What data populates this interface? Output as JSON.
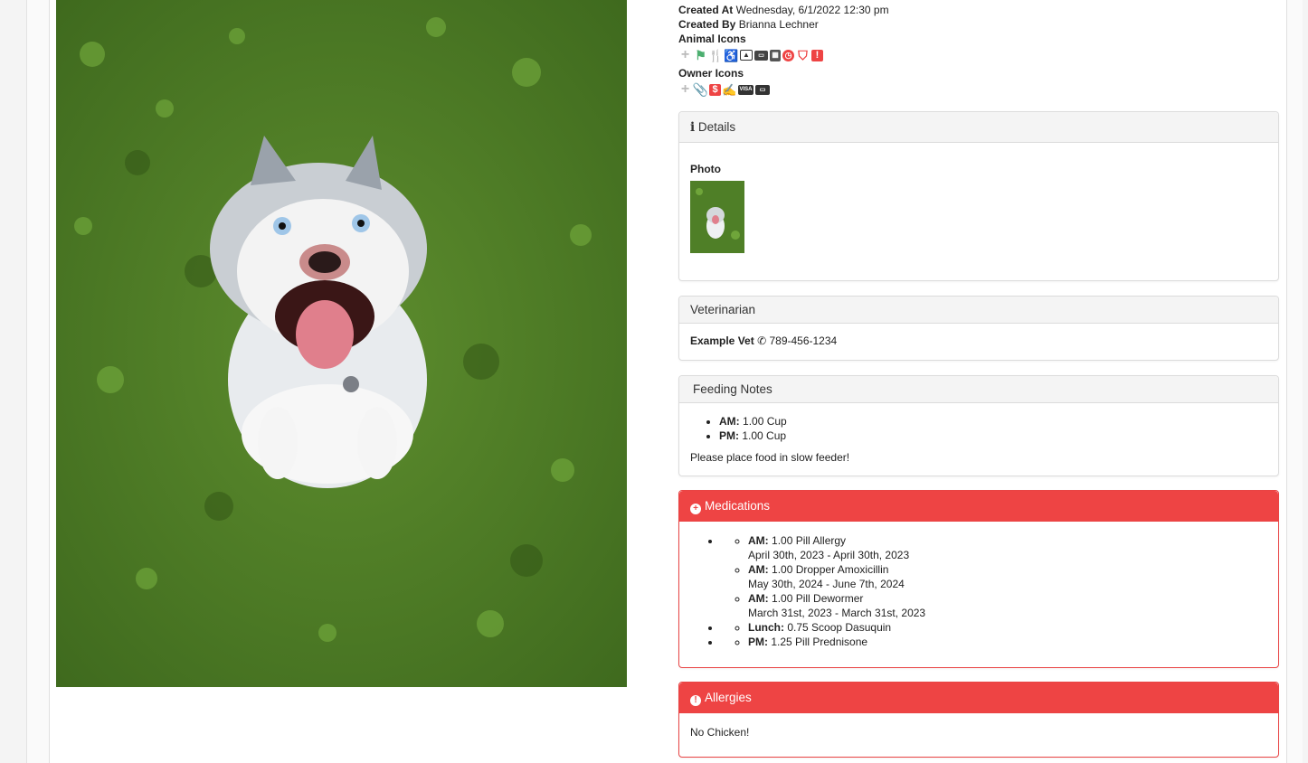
{
  "meta": {
    "created_at_label": "Created At",
    "created_at_value": "Wednesday, 6/1/2022 12:30 pm",
    "created_by_label": "Created By",
    "created_by_value": "Brianna Lechner",
    "animal_icons_label": "Animal Icons",
    "owner_icons_label": "Owner Icons"
  },
  "animal_icons": [
    "plus-icon",
    "flag-icon",
    "utensils-icon",
    "blind-icon",
    "image-icon",
    "id-card-icon",
    "building-icon",
    "clock-icon",
    "shield-icon",
    "alert-icon"
  ],
  "owner_icons": [
    "plus-icon",
    "paperclip-icon",
    "dollar-icon",
    "signature-icon",
    "visa-icon",
    "ticket-icon"
  ],
  "details": {
    "title": "Details",
    "photo_label": "Photo"
  },
  "vet": {
    "title": "Veterinarian",
    "name": "Example Vet",
    "phone": "789-456-1234"
  },
  "feeding": {
    "title": "Feeding Notes",
    "items": [
      {
        "label": "AM:",
        "value": "1.00 Cup"
      },
      {
        "label": "PM:",
        "value": "1.00 Cup"
      }
    ],
    "note": "Please place food in slow feeder!"
  },
  "medications": {
    "title": "Medications",
    "grouped": [
      {
        "label": "AM:",
        "value": "1.00 Pill Allergy",
        "dates": "April 30th, 2023 - April 30th, 2023"
      },
      {
        "label": "AM:",
        "value": "1.00 Dropper Amoxicillin",
        "dates": "May 30th, 2024 - June 7th, 2024"
      },
      {
        "label": "AM:",
        "value": "1.00 Pill Dewormer",
        "dates": "March 31st, 2023 - March 31st, 2023"
      }
    ],
    "single": [
      {
        "label": "Lunch:",
        "value": "0.75 Scoop Dasuquin"
      },
      {
        "label": "PM:",
        "value": "1.25 Pill Prednisone"
      }
    ]
  },
  "allergies": {
    "title": "Allergies",
    "text": "No Chicken!"
  },
  "colors": {
    "danger": "#ee4444",
    "panel_header": "#f4f4f4"
  }
}
